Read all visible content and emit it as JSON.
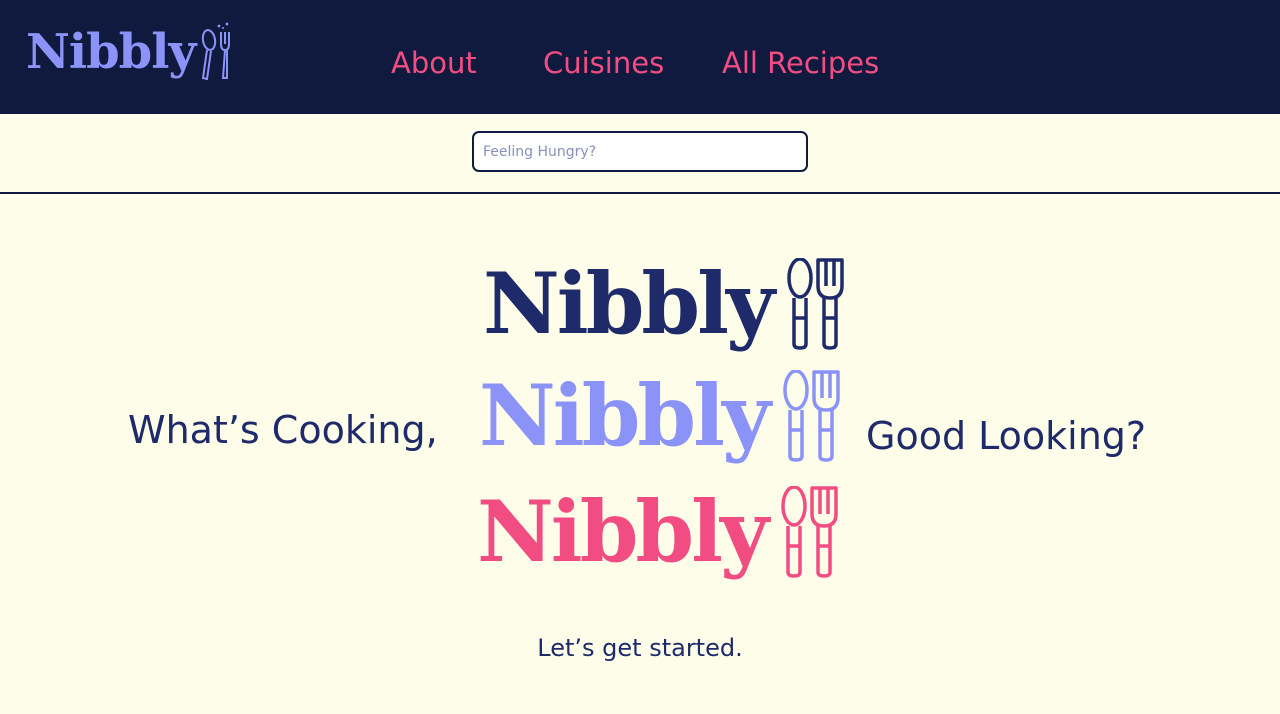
{
  "header": {
    "logo_text": "Nibbly",
    "nav": [
      {
        "label": "About"
      },
      {
        "label": "Cuisines"
      },
      {
        "label": "All Recipes"
      }
    ]
  },
  "search": {
    "placeholder": "Feeling Hungry?",
    "value": ""
  },
  "hero": {
    "tagline_left": "What’s Cooking,",
    "tagline_right": "Good Looking?",
    "brand_variants": [
      {
        "text": "Nibbly",
        "color": "#1e2a6a"
      },
      {
        "text": "Nibbly",
        "color": "#8b93f8"
      },
      {
        "text": "Nibbly",
        "color": "#f24d83"
      }
    ],
    "cta": "Let’s get started."
  },
  "colors": {
    "header_bg": "#10193e",
    "page_bg": "#fdfde9",
    "accent_pink": "#f24d83",
    "accent_periwinkle": "#8b93f8",
    "navy": "#1e2a6a"
  },
  "icons": [
    "spoon-fork-icon"
  ]
}
